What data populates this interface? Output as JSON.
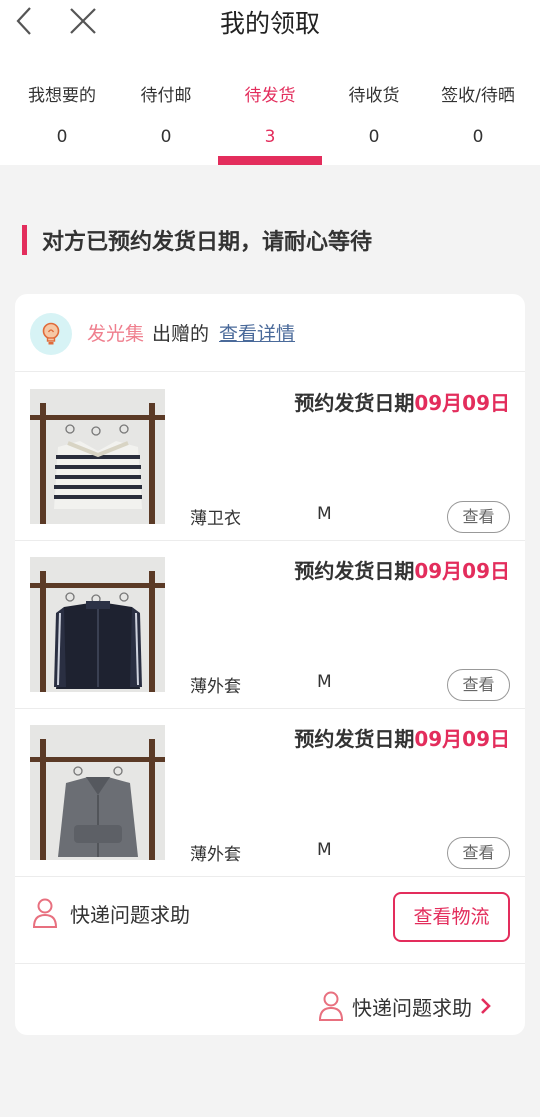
{
  "header": {
    "title": "我的领取"
  },
  "tabs": [
    {
      "label": "我想要的",
      "count": "0"
    },
    {
      "label": "待付邮",
      "count": "0"
    },
    {
      "label": "待发货",
      "count": "3"
    },
    {
      "label": "待收货",
      "count": "0"
    },
    {
      "label": "签收/待晒",
      "count": "0"
    }
  ],
  "notice": "对方已预约发货日期，请耐心等待",
  "giver": {
    "name": "发光集",
    "action": "出赠的",
    "link": "查看详情"
  },
  "date_label": "预约发货日期",
  "items": [
    {
      "date": "09月09日",
      "name": "薄卫衣",
      "size": "M",
      "button": "查看",
      "photo": "striped-knit-sweater"
    },
    {
      "date": "09月09日",
      "name": "薄外套",
      "size": "M",
      "button": "查看",
      "photo": "navy-track-jacket"
    },
    {
      "date": "09月09日",
      "name": "薄外套",
      "size": "M",
      "button": "查看",
      "photo": "grey-zip-hoodie"
    }
  ],
  "help": {
    "label": "快递问题求助",
    "logistics_button": "查看物流",
    "footer_link": "快递问题求助"
  },
  "colors": {
    "accent": "#e32d5c",
    "giver_name": "#ef7f8e",
    "link": "#4a6a9a"
  }
}
